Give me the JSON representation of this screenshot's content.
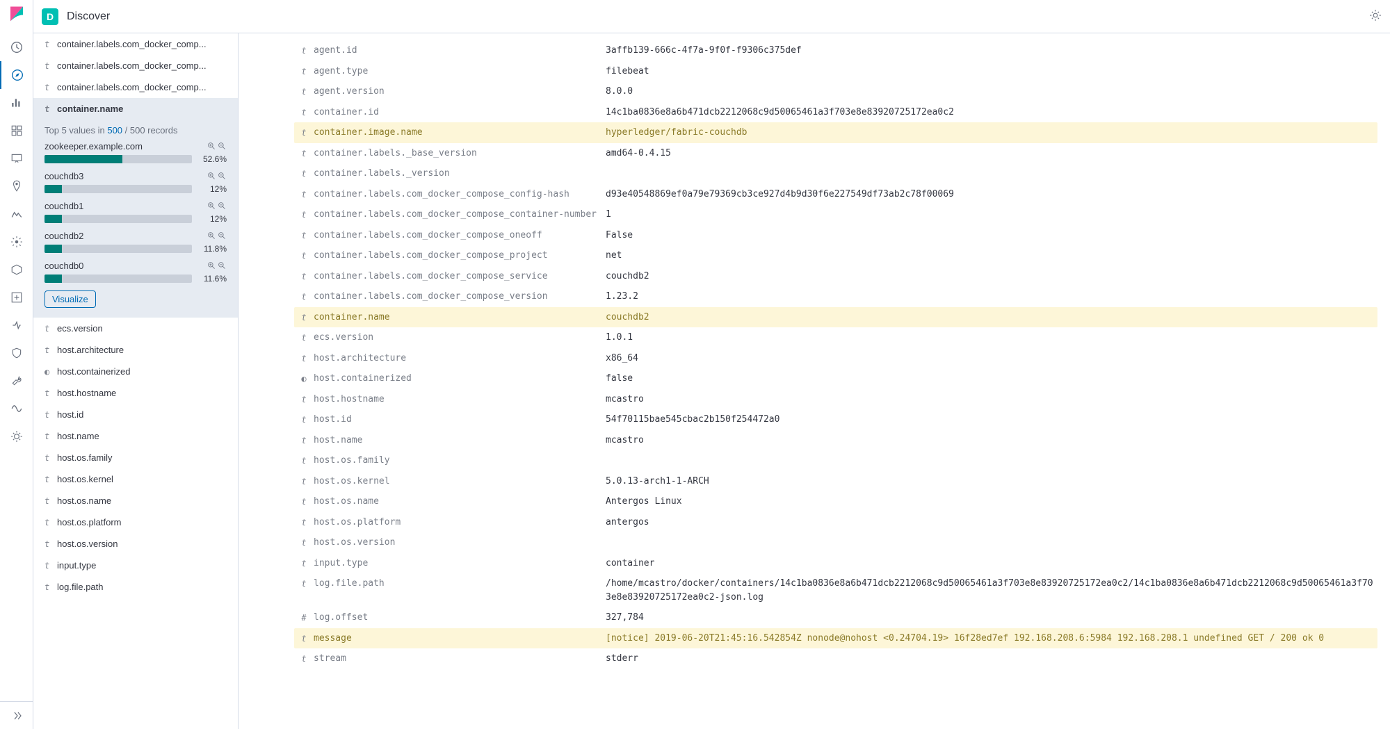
{
  "header": {
    "badge": "D",
    "title": "Discover"
  },
  "sidebar": {
    "beforeSelected": [
      {
        "type": "t",
        "name": "container.labels.com_docker_comp..."
      },
      {
        "type": "t",
        "name": "container.labels.com_docker_comp..."
      },
      {
        "type": "t",
        "name": "container.labels.com_docker_comp..."
      }
    ],
    "selected": {
      "type": "t",
      "name": "container.name"
    },
    "details": {
      "summary_prefix": "Top 5 values in ",
      "summary_count": "500",
      "summary_suffix": " / 500 records",
      "top_values": [
        {
          "name": "zookeeper.example.com",
          "pct": "52.6%",
          "bar": 52.6
        },
        {
          "name": "couchdb3",
          "pct": "12%",
          "bar": 12
        },
        {
          "name": "couchdb1",
          "pct": "12%",
          "bar": 12
        },
        {
          "name": "couchdb2",
          "pct": "11.8%",
          "bar": 11.8
        },
        {
          "name": "couchdb0",
          "pct": "11.6%",
          "bar": 11.6
        }
      ],
      "visualize": "Visualize"
    },
    "afterSelected": [
      {
        "type": "t",
        "name": "ecs.version"
      },
      {
        "type": "t",
        "name": "host.architecture"
      },
      {
        "type": "◐",
        "name": "host.containerized"
      },
      {
        "type": "t",
        "name": "host.hostname"
      },
      {
        "type": "t",
        "name": "host.id"
      },
      {
        "type": "t",
        "name": "host.name"
      },
      {
        "type": "t",
        "name": "host.os.family"
      },
      {
        "type": "t",
        "name": "host.os.kernel"
      },
      {
        "type": "t",
        "name": "host.os.name"
      },
      {
        "type": "t",
        "name": "host.os.platform"
      },
      {
        "type": "t",
        "name": "host.os.version"
      },
      {
        "type": "t",
        "name": "input.type"
      },
      {
        "type": "t",
        "name": "log.file.path"
      }
    ]
  },
  "doc_rows": [
    {
      "type": "t",
      "field": "agent.id",
      "value": "3affb139-666c-4f7a-9f0f-f9306c375def",
      "hl": false
    },
    {
      "type": "t",
      "field": "agent.type",
      "value": "filebeat",
      "hl": false
    },
    {
      "type": "t",
      "field": "agent.version",
      "value": "8.0.0",
      "hl": false
    },
    {
      "type": "t",
      "field": "container.id",
      "value": "14c1ba0836e8a6b471dcb2212068c9d50065461a3f703e8e83920725172ea0c2",
      "hl": false
    },
    {
      "type": "t",
      "field": "container.image.name",
      "value": "hyperledger/fabric-couchdb",
      "hl": true
    },
    {
      "type": "t",
      "field": "container.labels._base_version",
      "value": "amd64-0.4.15",
      "hl": false
    },
    {
      "type": "t",
      "field": "container.labels._version",
      "value": "",
      "hl": false
    },
    {
      "type": "t",
      "field": "container.labels.com_docker_compose_config-hash",
      "value": "d93e40548869ef0a79e79369cb3ce927d4b9d30f6e227549df73ab2c78f00069",
      "hl": false
    },
    {
      "type": "t",
      "field": "container.labels.com_docker_compose_container-number",
      "value": "1",
      "hl": false
    },
    {
      "type": "t",
      "field": "container.labels.com_docker_compose_oneoff",
      "value": "False",
      "hl": false
    },
    {
      "type": "t",
      "field": "container.labels.com_docker_compose_project",
      "value": "net",
      "hl": false
    },
    {
      "type": "t",
      "field": "container.labels.com_docker_compose_service",
      "value": "couchdb2",
      "hl": false
    },
    {
      "type": "t",
      "field": "container.labels.com_docker_compose_version",
      "value": "1.23.2",
      "hl": false
    },
    {
      "type": "t",
      "field": "container.name",
      "value": "couchdb2",
      "hl": true
    },
    {
      "type": "t",
      "field": "ecs.version",
      "value": "1.0.1",
      "hl": false
    },
    {
      "type": "t",
      "field": "host.architecture",
      "value": "x86_64",
      "hl": false
    },
    {
      "type": "◐",
      "field": "host.containerized",
      "value": "false",
      "hl": false
    },
    {
      "type": "t",
      "field": "host.hostname",
      "value": "mcastro",
      "hl": false
    },
    {
      "type": "t",
      "field": "host.id",
      "value": "54f70115bae545cbac2b150f254472a0",
      "hl": false
    },
    {
      "type": "t",
      "field": "host.name",
      "value": "mcastro",
      "hl": false
    },
    {
      "type": "t",
      "field": "host.os.family",
      "value": "",
      "hl": false
    },
    {
      "type": "t",
      "field": "host.os.kernel",
      "value": "5.0.13-arch1-1-ARCH",
      "hl": false
    },
    {
      "type": "t",
      "field": "host.os.name",
      "value": "Antergos Linux",
      "hl": false
    },
    {
      "type": "t",
      "field": "host.os.platform",
      "value": "antergos",
      "hl": false
    },
    {
      "type": "t",
      "field": "host.os.version",
      "value": "",
      "hl": false
    },
    {
      "type": "t",
      "field": "input.type",
      "value": "container",
      "hl": false
    },
    {
      "type": "t",
      "field": "log.file.path",
      "value": "/home/mcastro/docker/containers/14c1ba0836e8a6b471dcb2212068c9d50065461a3f703e8e83920725172ea0c2/14c1ba0836e8a6b471dcb2212068c9d50065461a3f703e8e83920725172ea0c2-json.log",
      "hl": false
    },
    {
      "type": "#",
      "field": "log.offset",
      "value": "327,784",
      "hl": false
    },
    {
      "type": "t",
      "field": "message",
      "value": "[notice] 2019-06-20T21:45:16.542854Z nonode@nohost <0.24704.19> 16f28ed7ef 192.168.208.6:5984 192.168.208.1 undefined GET / 200 ok 0",
      "hl": true
    },
    {
      "type": "t",
      "field": "stream",
      "value": "stderr",
      "hl": false
    }
  ]
}
